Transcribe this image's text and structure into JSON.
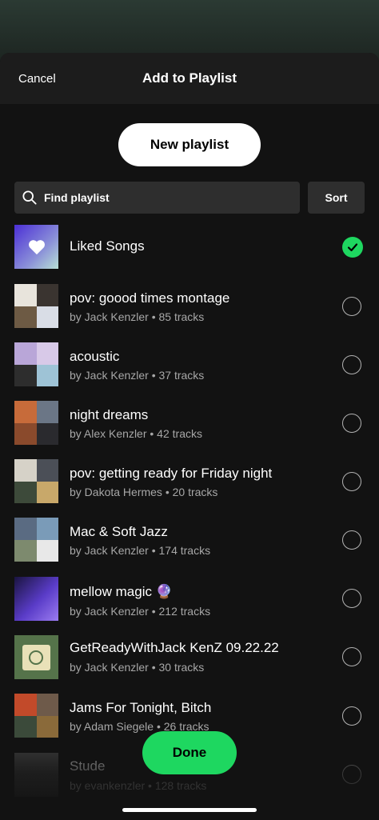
{
  "header": {
    "cancel_label": "Cancel",
    "title": "Add to Playlist"
  },
  "new_playlist_label": "New playlist",
  "search": {
    "placeholder": "Find playlist",
    "icon": "search-icon"
  },
  "sort_label": "Sort",
  "done_label": "Done",
  "colors": {
    "accent": "#1ed760",
    "background": "#121212",
    "subtext": "#a7a7a7"
  },
  "playlists": [
    {
      "title": "Liked Songs",
      "subtitle": "",
      "selected": true,
      "icon": "heart-icon"
    },
    {
      "title": "pov: goood times montage",
      "subtitle": "by Jack Kenzler • 85 tracks",
      "selected": false
    },
    {
      "title": "acoustic",
      "subtitle": "by Jack Kenzler • 37 tracks",
      "selected": false
    },
    {
      "title": "night dreams",
      "subtitle": "by Alex Kenzler • 42 tracks",
      "selected": false
    },
    {
      "title": "pov: getting ready for Friday night",
      "subtitle": "by Dakota Hermes • 20 tracks",
      "selected": false
    },
    {
      "title": "Mac & Soft Jazz",
      "subtitle": "by Jack Kenzler • 174 tracks",
      "selected": false
    },
    {
      "title": "mellow magic 🔮",
      "subtitle": "by Jack Kenzler • 212 tracks",
      "selected": false
    },
    {
      "title": "GetReadyWithJack KenZ 09.22.22",
      "subtitle": "by Jack Kenzler • 30 tracks",
      "selected": false
    },
    {
      "title": "Jams For Tonight, Bitch",
      "subtitle": "by Adam Siegele • 26 tracks",
      "selected": false
    },
    {
      "title": "Stude",
      "subtitle": "by evankenzler • 128 tracks",
      "selected": false
    }
  ]
}
